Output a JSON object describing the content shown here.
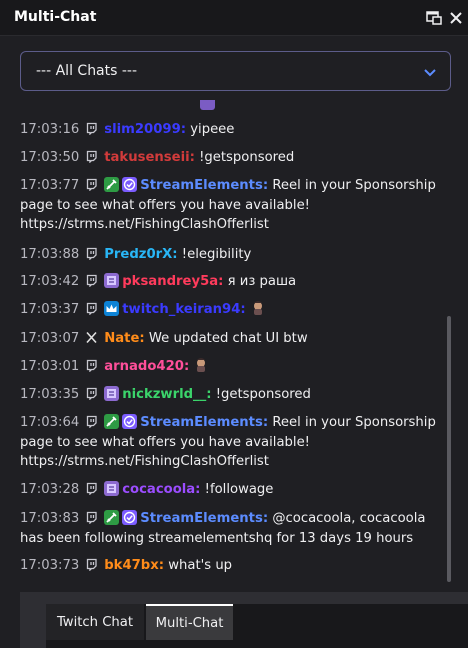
{
  "window": {
    "title": "Multi-Chat"
  },
  "filter": {
    "selected": "--- All Chats ---"
  },
  "messages": [
    {
      "time": "17:03:16",
      "platform": "twitch",
      "badges": [],
      "user": "slim20099:",
      "color": "#3b3bff",
      "text": "yipeee"
    },
    {
      "time": "17:03:50",
      "platform": "twitch",
      "badges": [],
      "user": "takusenseii:",
      "color": "#d23b3b",
      "text": "!getsponsored"
    },
    {
      "time": "17:03:77",
      "platform": "twitch",
      "badges": [
        "broadcaster-badge",
        "verified-badge"
      ],
      "user": "StreamElements:",
      "color": "#5c8cff",
      "text": "Reel in your Sponsorship page to see what offers you have available! https://strms.net/FishingClashOfferlist"
    },
    {
      "time": "17:03:88",
      "platform": "twitch",
      "badges": [],
      "user": "Predz0rX:",
      "color": "#29b6f6",
      "text": "!elegibility"
    },
    {
      "time": "17:03:42",
      "platform": "twitch",
      "badges": [
        "sub-badge"
      ],
      "user": "pksandrey5a:",
      "color": "#ff3b5c",
      "text": "я из раша"
    },
    {
      "time": "17:03:37",
      "platform": "twitch",
      "badges": [
        "prime-badge"
      ],
      "user": "twitch_keiran94:",
      "color": "#3b3bff",
      "text": ""
    },
    {
      "time": "17:03:07",
      "platform": "x",
      "badges": [],
      "user": "Nate:",
      "color": "#ff8c1a",
      "text": "We updated chat UI btw"
    },
    {
      "time": "17:03:01",
      "platform": "twitch",
      "badges": [],
      "user": "arnado420:",
      "color": "#ff4f9a",
      "text": ""
    },
    {
      "time": "17:03:35",
      "platform": "twitch",
      "badges": [
        "sub-badge"
      ],
      "user": "nickzwrld__:",
      "color": "#3bd46b",
      "text": "!getsponsored"
    },
    {
      "time": "17:03:64",
      "platform": "twitch",
      "badges": [
        "broadcaster-badge",
        "verified-badge"
      ],
      "user": "StreamElements:",
      "color": "#5c8cff",
      "text": "Reel in your Sponsorship page to see what offers you have available! https://strms.net/FishingClashOfferlist"
    },
    {
      "time": "17:03:28",
      "platform": "twitch",
      "badges": [
        "sub-badge"
      ],
      "user": "cocacoola:",
      "color": "#9b4dff",
      "text": "!followage"
    },
    {
      "time": "17:03:83",
      "platform": "twitch",
      "badges": [
        "broadcaster-badge",
        "verified-badge"
      ],
      "user": "StreamElements:",
      "color": "#5c8cff",
      "text": "@cocacoola, cocacoola has been following streamelementshq for 13 days 19 hours"
    },
    {
      "time": "17:03:73",
      "platform": "twitch",
      "badges": [],
      "user": "bk47bx:",
      "color": "#ff8c1a",
      "text": "what's up"
    }
  ],
  "tabs": [
    {
      "label": "Twitch Chat",
      "active": false
    },
    {
      "label": "Multi-Chat",
      "active": true
    }
  ]
}
